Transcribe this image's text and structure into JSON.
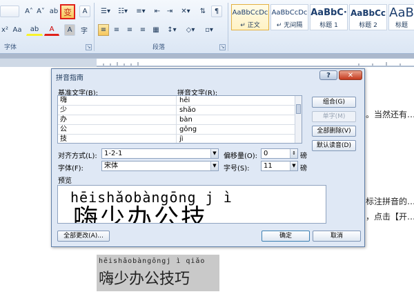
{
  "ribbon": {
    "font_group_label": "字体",
    "paragraph_group_label": "段落",
    "font_buttons": [
      "A˄",
      "A˅",
      "ab",
      "变",
      "A"
    ],
    "font_row2": [
      "x²",
      "Aa",
      "ab",
      "A",
      "A",
      "字"
    ],
    "styles": [
      {
        "sample": "AaBbCcDc",
        "name": "↵ 正文"
      },
      {
        "sample": "AaBbCcDc",
        "name": "↵ 无间隔"
      },
      {
        "sample": "AaBbC·",
        "name": "标题 1"
      },
      {
        "sample": "AaBbCc",
        "name": "标题 2"
      },
      {
        "sample": "AaB",
        "name": "标题"
      }
    ]
  },
  "document": {
    "right_text_1": "。当然还有…",
    "right_text_2": "标注拼音的…",
    "right_text_3": "，点击【开…",
    "sample_ruby": "hēishǎobàngōngj ì qiǎo",
    "sample_base": "嗨少办公技巧"
  },
  "dialog": {
    "title": "拼音指南",
    "help_label": "?",
    "close_label": "✕",
    "base_text_header": "基准文字(B):",
    "ruby_text_header": "拼音文字(R):",
    "rows": [
      {
        "base": "嗨",
        "ruby": "hēi"
      },
      {
        "base": "少",
        "ruby": "shǎo"
      },
      {
        "base": "办",
        "ruby": "bàn"
      },
      {
        "base": "公",
        "ruby": "gōng"
      },
      {
        "base": "技",
        "ruby": "jì"
      }
    ],
    "buttons": {
      "combine": "组合(G)",
      "single": "单字(M)",
      "delete_all": "全部删除(V)",
      "default_reading": "默认读音(D)",
      "change_all": "全部更改(A)...",
      "ok": "确定",
      "cancel": "取消"
    },
    "alignment_label": "对齐方式(L):",
    "alignment_value": "1-2-1",
    "offset_label": "偏移量(O):",
    "offset_value": "0",
    "offset_unit": "磅",
    "font_label": "字体(F):",
    "font_value": "宋体",
    "size_label": "字号(S):",
    "size_value": "11",
    "size_unit": "磅",
    "preview_label": "预览",
    "preview_ruby": "hēishǎobàngōng j ì",
    "preview_base": "嗨少办公技"
  }
}
